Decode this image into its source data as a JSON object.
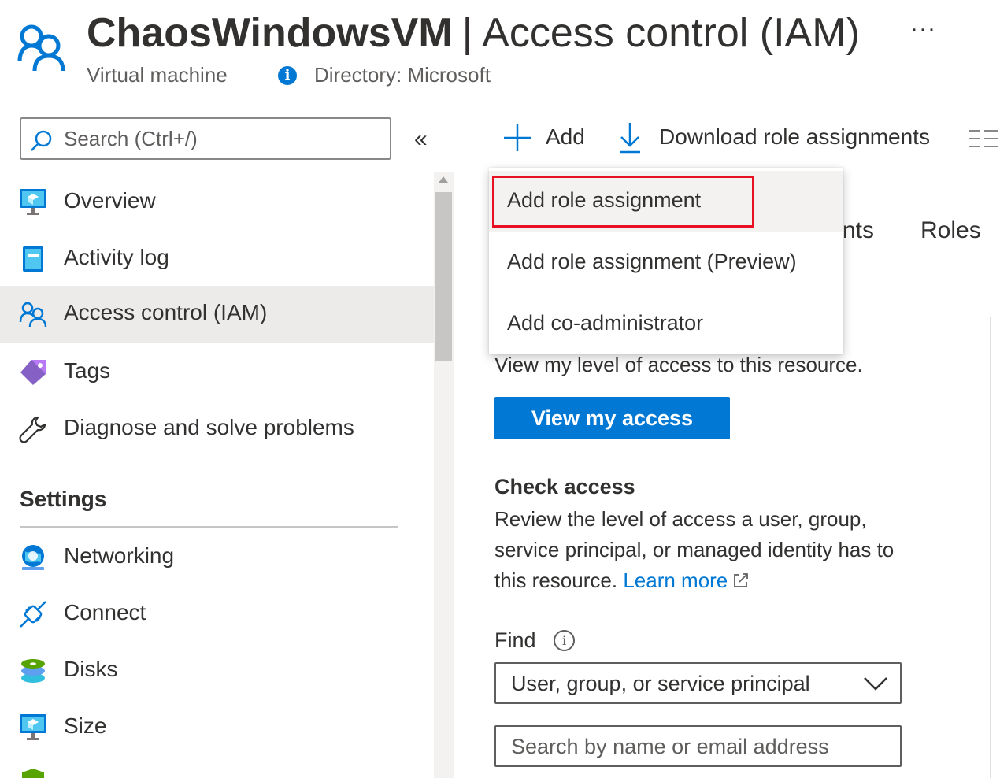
{
  "header": {
    "resource_name": "ChaosWindowsVM",
    "separator": "|",
    "page_name": "Access control (IAM)",
    "more_label": "···",
    "resource_type": "Virtual machine",
    "directory": "Directory: Microsoft"
  },
  "sidebar": {
    "search_placeholder": "Search (Ctrl+/)",
    "collapse_label": "«",
    "items": [
      {
        "label": "Overview",
        "icon": "vm-monitor-icon"
      },
      {
        "label": "Activity log",
        "icon": "activity-log-icon"
      },
      {
        "label": "Access control (IAM)",
        "icon": "users-icon",
        "selected": true
      },
      {
        "label": "Tags",
        "icon": "tag-icon"
      },
      {
        "label": "Diagnose and solve problems",
        "icon": "wrench-icon"
      }
    ],
    "settings_header": "Settings",
    "settings_items": [
      {
        "label": "Networking",
        "icon": "networking-icon"
      },
      {
        "label": "Connect",
        "icon": "connect-icon"
      },
      {
        "label": "Disks",
        "icon": "disks-icon"
      },
      {
        "label": "Size",
        "icon": "vm-monitor-icon"
      }
    ]
  },
  "toolbar": {
    "add_label": "Add",
    "download_label": "Download role assignments"
  },
  "add_menu": {
    "items": [
      {
        "label": "Add role assignment",
        "highlighted": true
      },
      {
        "label": "Add role assignment (Preview)"
      },
      {
        "label": "Add co-administrator"
      }
    ]
  },
  "tabs": {
    "partial_label": "nts",
    "roles_label": "Roles"
  },
  "my_access": {
    "description": "View my level of access to this resource.",
    "button_label": "View my access"
  },
  "check_access": {
    "title": "Check access",
    "description": "Review the level of access a user, group, service principal, or managed identity has to this resource.",
    "learn_more": "Learn more",
    "find_label": "Find",
    "find_value": "User, group, or service principal",
    "search_placeholder": "Search by name or email address"
  },
  "colors": {
    "accent": "#0078d4",
    "highlight_border": "#e81123",
    "selected_bg": "#edebe9"
  }
}
